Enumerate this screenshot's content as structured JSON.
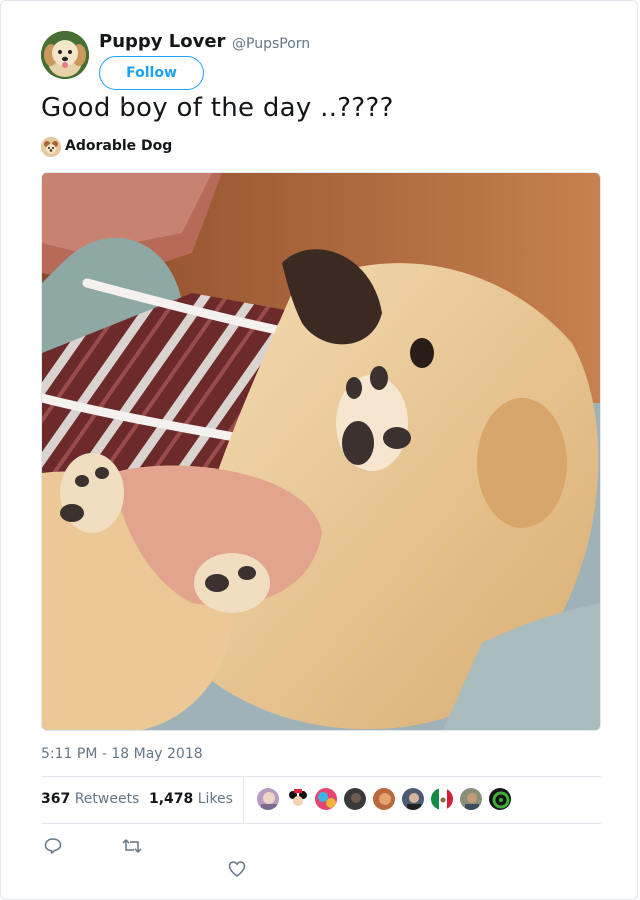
{
  "author": {
    "name": "Puppy Lover",
    "handle": "@PupsPorn",
    "follow_label": "Follow"
  },
  "tweet": {
    "text": "Good boy of the day ..????",
    "context_label": "Adorable Dog",
    "timestamp": "5:11 PM - 18 May 2018"
  },
  "stats": {
    "retweets_count": "367",
    "retweets_label": "Retweets",
    "likes_count": "1,478",
    "likes_label": "Likes"
  },
  "likers": [
    {
      "icon": "liker-avatar",
      "color": "#b79cc0"
    },
    {
      "icon": "minnie-mouse-avatar",
      "color": "#ffffff"
    },
    {
      "icon": "colorful-avatar",
      "color": "#e6456f"
    },
    {
      "icon": "dark-avatar",
      "color": "#3b3a3a"
    },
    {
      "icon": "orange-avatar",
      "color": "#b86a3e"
    },
    {
      "icon": "person-avatar",
      "color": "#4c5a74"
    },
    {
      "icon": "mexico-flag-avatar",
      "color": "#ffffff"
    },
    {
      "icon": "person-avatar-2",
      "color": "#8a8f7a"
    },
    {
      "icon": "green-logo-avatar",
      "color": "#151515"
    }
  ],
  "colors": {
    "accent": "#1da1f2",
    "muted": "#657786",
    "text": "#14171a",
    "border": "#e1e8ed"
  }
}
